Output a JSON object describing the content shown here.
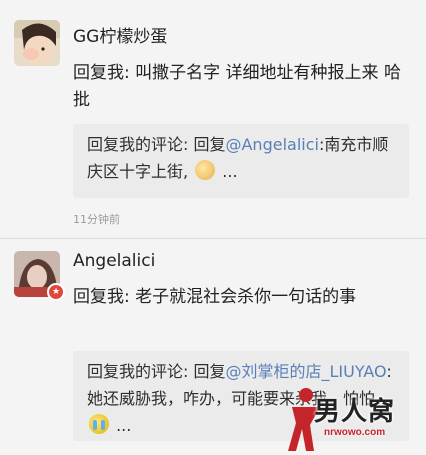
{
  "comments": [
    {
      "username": "GG柠檬炒蛋",
      "reply": "回复我: 叫撒子名字 详细地址有种报上来 哈批",
      "quote": {
        "prefix": "回复我的评论: 回复",
        "mention": "@Angelalici",
        "rest": ":南充市顺庆区十字上街,",
        "suffix": "..."
      },
      "timestamp": "11分钟前",
      "avatar_icon": "user-avatar-photo"
    },
    {
      "username": "Angelalici",
      "reply": "回复我: 老子就混社会杀你一句话的事",
      "quote": {
        "prefix": "回复我的评论: 回复",
        "mention": "@刘掌柜的店_LIUYAO",
        "rest": ":她还威胁我，咋办，可能要来杀我，怕怕",
        "suffix": "..."
      },
      "avatar_icon": "user-avatar-photo",
      "badge_icon": "star-badge-icon"
    }
  ],
  "watermark": {
    "text": "男人窝",
    "url": "nrwowo.com"
  },
  "colors": {
    "background": "#f4f4f4",
    "quote_background": "#ebebeb",
    "mention": "#5a7fb8",
    "timestamp": "#9a9a9a",
    "badge": "#e0473c"
  }
}
